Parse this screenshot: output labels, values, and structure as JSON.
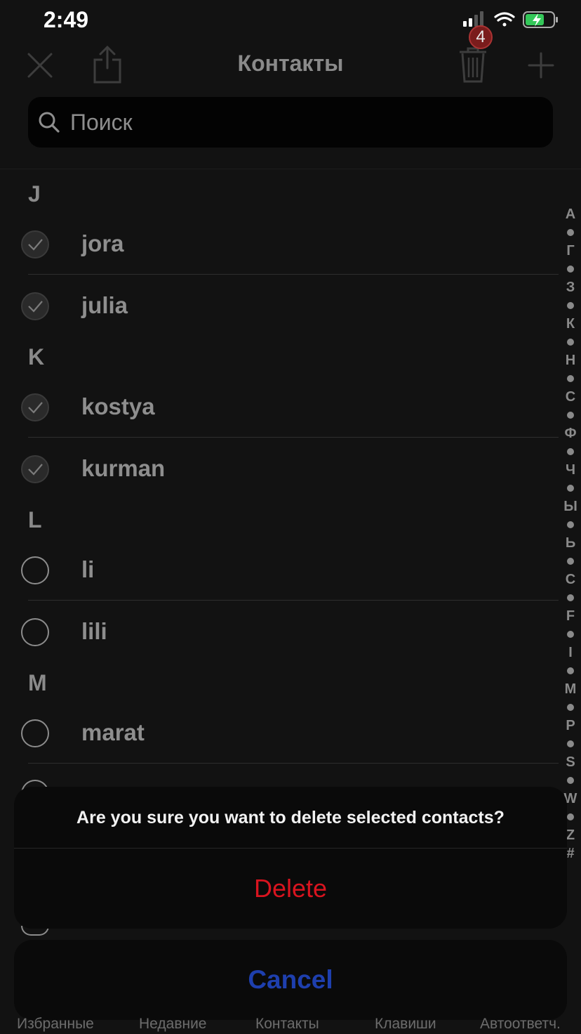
{
  "status_bar": {
    "time": "2:49"
  },
  "nav": {
    "title": "Контакты",
    "selected_count": "4"
  },
  "search": {
    "placeholder": "Поиск"
  },
  "sections": [
    {
      "letter": "J",
      "contacts": [
        {
          "name": "jora",
          "selected": true
        },
        {
          "name": "julia",
          "selected": true
        }
      ]
    },
    {
      "letter": "K",
      "contacts": [
        {
          "name": "kostya",
          "selected": true
        },
        {
          "name": "kurman",
          "selected": true
        }
      ]
    },
    {
      "letter": "L",
      "contacts": [
        {
          "name": "li",
          "selected": false
        },
        {
          "name": "lili",
          "selected": false
        }
      ]
    },
    {
      "letter": "M",
      "contacts": [
        {
          "name": "marat",
          "selected": false
        }
      ]
    }
  ],
  "index": [
    "A",
    "Г",
    "З",
    "К",
    "Н",
    "С",
    "Ф",
    "Ч",
    "Ы",
    "Ь",
    "C",
    "F",
    "I",
    "M",
    "P",
    "S",
    "W",
    "Z",
    "#"
  ],
  "action_sheet": {
    "message": "Are you sure you want to delete selected contacts?",
    "delete_label": "Delete",
    "cancel_label": "Cancel"
  },
  "tabs": [
    "Избранные",
    "Недавние",
    "Контакты",
    "Клавиши",
    "Автоответч."
  ],
  "colors": {
    "destructive": "#d8141f",
    "cancel": "#1e3fae",
    "background": "#121212"
  }
}
